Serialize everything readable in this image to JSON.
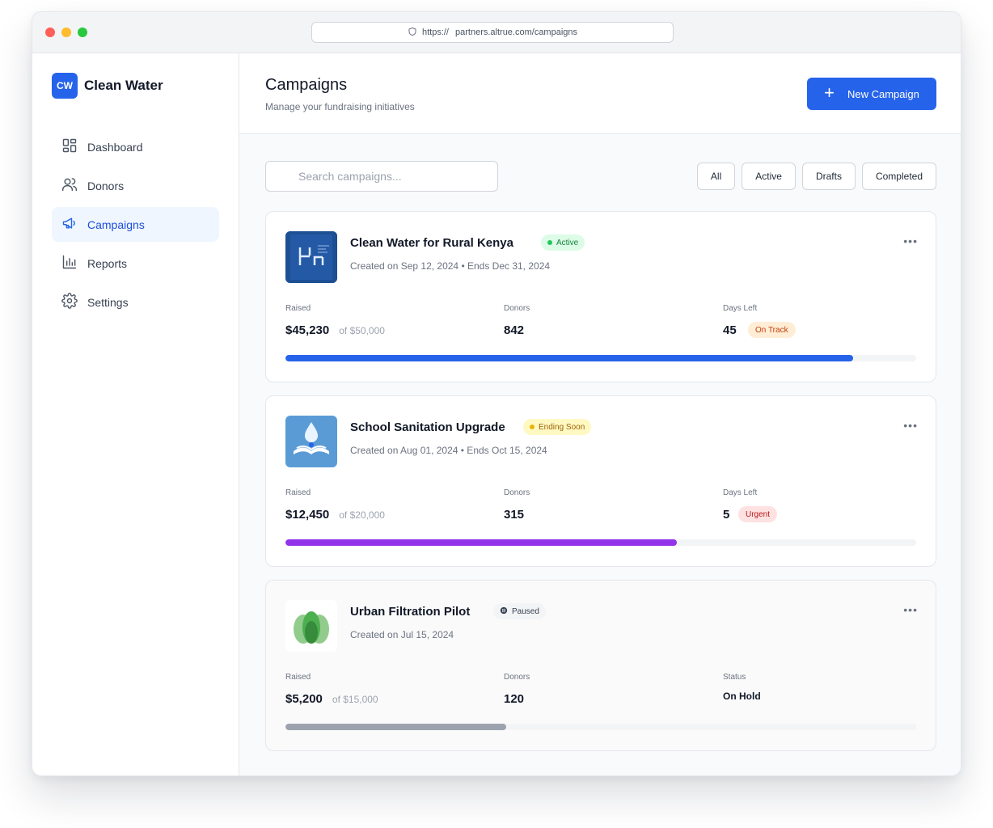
{
  "browser": {
    "url_scheme": "https://",
    "url_host": "partners.altrue.com/campaigns"
  },
  "brand": {
    "logo_text": "CW",
    "name": "Clean Water"
  },
  "nav": [
    {
      "label": "Dashboard",
      "icon": "dashboard-icon",
      "active": false
    },
    {
      "label": "Donors",
      "icon": "users-icon",
      "active": false
    },
    {
      "label": "Campaigns",
      "icon": "megaphone-icon",
      "active": true
    },
    {
      "label": "Reports",
      "icon": "bar-chart-icon",
      "active": false
    },
    {
      "label": "Settings",
      "icon": "gear-icon",
      "active": false
    }
  ],
  "header": {
    "title": "Campaigns",
    "subtitle": "Manage your fundraising initiatives",
    "new_button": "New Campaign"
  },
  "search": {
    "placeholder": "Search campaigns..."
  },
  "filters": [
    "All",
    "Active",
    "Drafts",
    "Completed"
  ],
  "colors": {
    "accent": "#2563eb",
    "progress_active": "#2563eb",
    "progress_ending": "#9333ea",
    "progress_paused": "#9ca3af"
  },
  "campaigns": [
    {
      "title": "Clean Water for Rural Kenya",
      "badge": "Active",
      "meta": "Created on Sep 12, 2024 • Ends Dec 31, 2024",
      "raised_label": "Raised",
      "raised": "$45,230",
      "goal": "of $50,000",
      "donors_label": "Donors",
      "donors": "842",
      "third_label": "Days Left",
      "days_left": "45",
      "pill": "On Track",
      "progress": 0.9
    },
    {
      "title": "School Sanitation Upgrade",
      "badge": "Ending Soon",
      "meta": "Created on Aug 01, 2024 • Ends Oct 15, 2024",
      "raised_label": "Raised",
      "raised": "$12,450",
      "goal": "of $20,000",
      "donors_label": "Donors",
      "donors": "315",
      "third_label": "Days Left",
      "days_left": "5",
      "pill": "Urgent",
      "progress": 0.62
    },
    {
      "title": "Urban Filtration Pilot",
      "badge": "Paused",
      "meta": "Created on Jul 15, 2024",
      "raised_label": "Raised",
      "raised": "$5,200",
      "goal": "of $15,000",
      "donors_label": "Donors",
      "donors": "120",
      "third_label": "Status",
      "status": "On Hold",
      "progress": 0.35
    }
  ]
}
